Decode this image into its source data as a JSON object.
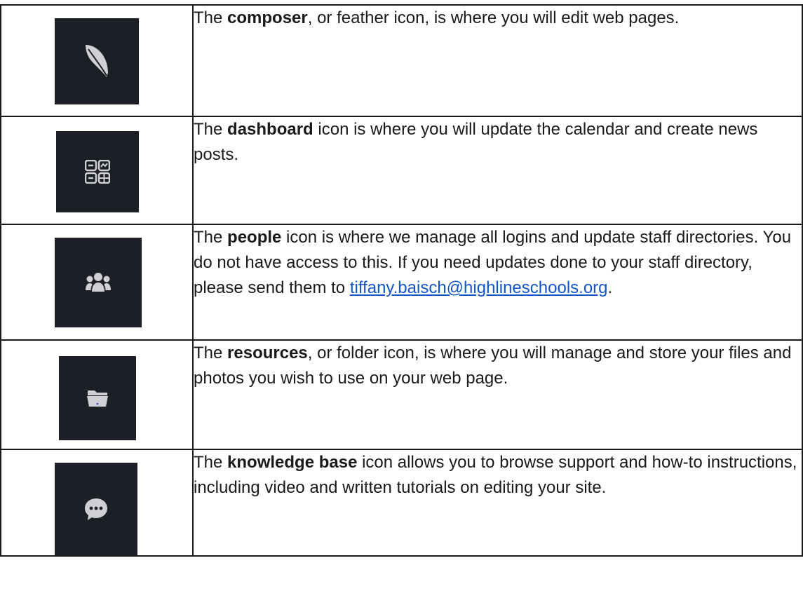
{
  "rows": [
    {
      "icon": "feather-icon",
      "before": "The ",
      "bold": "composer",
      "after": ", or feather icon, is where you will edit web pages."
    },
    {
      "icon": "dashboard-icon",
      "before": "The ",
      "bold": "dashboard",
      "after": " icon is where you will update the calendar and create news posts."
    },
    {
      "icon": "people-icon",
      "before": "The ",
      "bold": "people",
      "after": " icon is where we manage all logins and update staff directories. You do not have access to this. If you need updates done to your staff directory, please send them to ",
      "link": "tiffany.baisch@highlineschools.org",
      "end": "."
    },
    {
      "icon": "folder-icon",
      "before": "The ",
      "bold": "resources",
      "after": ", or folder icon, is where you will manage and store your files and photos you wish to use on your web page."
    },
    {
      "icon": "chat-bubble-icon",
      "before": "The ",
      "bold": "knowledge base",
      "after": " icon allows you to browse support and how-to instructions, including video and written tutorials on editing your site."
    }
  ],
  "colors": {
    "tile_bg": "#1c1f26",
    "icon_fill": "#cfcfd4",
    "link": "#1155cc",
    "border": "#1a1a1a"
  }
}
